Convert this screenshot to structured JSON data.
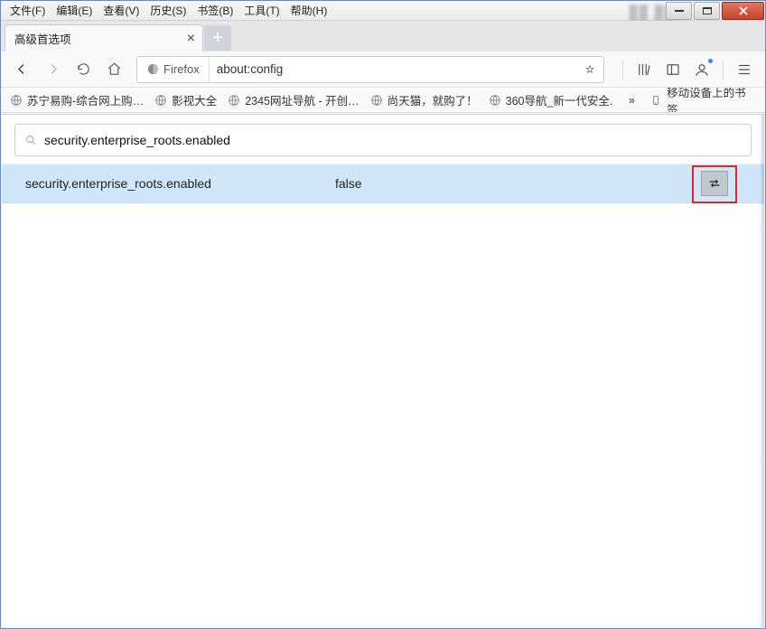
{
  "menus": {
    "file": "文件(F)",
    "edit": "编辑(E)",
    "view": "查看(V)",
    "history": "历史(S)",
    "bookmarks": "书签(B)",
    "tools": "工具(T)",
    "help": "帮助(H)"
  },
  "tab": {
    "title": "高级首选项"
  },
  "urlbar": {
    "identity": "Firefox",
    "address": "about:config"
  },
  "bookmarks": {
    "b1": "苏宁易购-综合网上购…",
    "b2": "影视大全",
    "b3": "2345网址导航 - 开创…",
    "b4": "尚天猫，就购了！",
    "b5": "360导航_新一代安全.",
    "right": "移动设备上的书签"
  },
  "config": {
    "search_value": "security.enterprise_roots.enabled",
    "pref_name": "security.enterprise_roots.enabled",
    "pref_value": "false"
  }
}
